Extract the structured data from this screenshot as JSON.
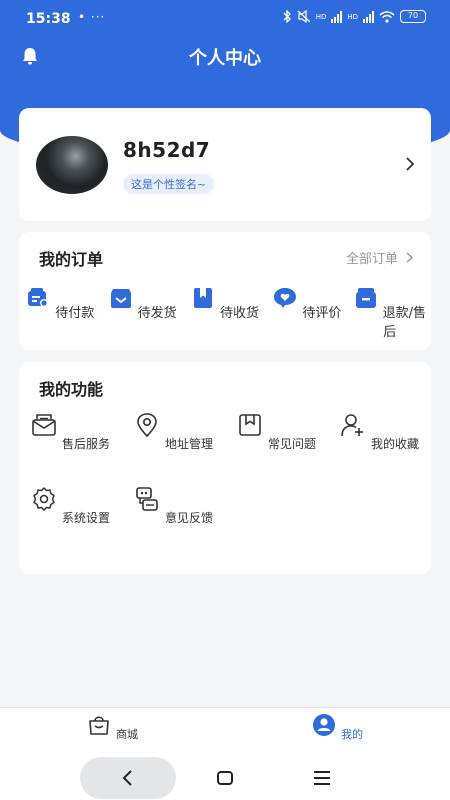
{
  "status_bar": {
    "time": "15:38",
    "dots": "• ···",
    "signal_label_1": "HD",
    "signal_label_2": "HD",
    "battery": "70"
  },
  "header": {
    "title": "个人中心"
  },
  "profile": {
    "username": "8h52d7",
    "signature": "这是个性签名~"
  },
  "orders": {
    "title": "我的订单",
    "all_label": "全部订单",
    "items": [
      {
        "label": "待付款",
        "icon": "wallet-icon"
      },
      {
        "label": "待发货",
        "icon": "package-icon"
      },
      {
        "label": "待收货",
        "icon": "bookmark-box-icon"
      },
      {
        "label": "待评价",
        "icon": "comment-heart-icon"
      },
      {
        "label": "退款/售后",
        "icon": "refund-box-icon"
      }
    ]
  },
  "functions": {
    "title": "我的功能",
    "items": [
      {
        "label": "售后服务",
        "icon": "mail-icon"
      },
      {
        "label": "地址管理",
        "icon": "location-icon"
      },
      {
        "label": "常见问题",
        "icon": "bookmark-icon"
      },
      {
        "label": "我的收藏",
        "icon": "user-plus-icon"
      },
      {
        "label": "系统设置",
        "icon": "gear-icon"
      },
      {
        "label": "意见反馈",
        "icon": "feedback-icon"
      }
    ]
  },
  "tabbar": {
    "tabs": [
      {
        "label": "商城",
        "icon": "shop-bag-icon",
        "active": false
      },
      {
        "label": "我的",
        "icon": "user-icon",
        "active": true
      }
    ]
  },
  "colors": {
    "primary": "#2f6bdc",
    "background": "#f4f5f7",
    "signature_bg": "#e8effc"
  }
}
